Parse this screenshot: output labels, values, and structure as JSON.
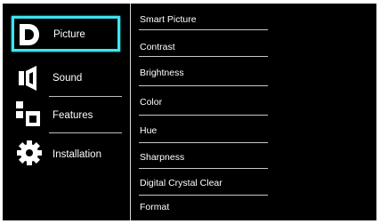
{
  "main_menu": {
    "items": [
      {
        "label": "Picture",
        "icon": "picture-icon",
        "selected": true
      },
      {
        "label": "Sound",
        "icon": "sound-icon",
        "selected": false
      },
      {
        "label": "Features",
        "icon": "features-icon",
        "selected": false
      },
      {
        "label": "Installation",
        "icon": "installation-icon",
        "selected": false
      }
    ]
  },
  "submenu": {
    "items": [
      {
        "label": "Smart Picture"
      },
      {
        "label": "Contrast"
      },
      {
        "label": "Brightness"
      },
      {
        "label": "Color"
      },
      {
        "label": "Hue"
      },
      {
        "label": "Sharpness"
      },
      {
        "label": "Digital Crystal Clear"
      },
      {
        "label": "Format"
      }
    ]
  },
  "colors": {
    "background": "#000000",
    "text": "#ffffff",
    "highlight": "#3ee4ee",
    "separator": "#c8c8c8"
  }
}
